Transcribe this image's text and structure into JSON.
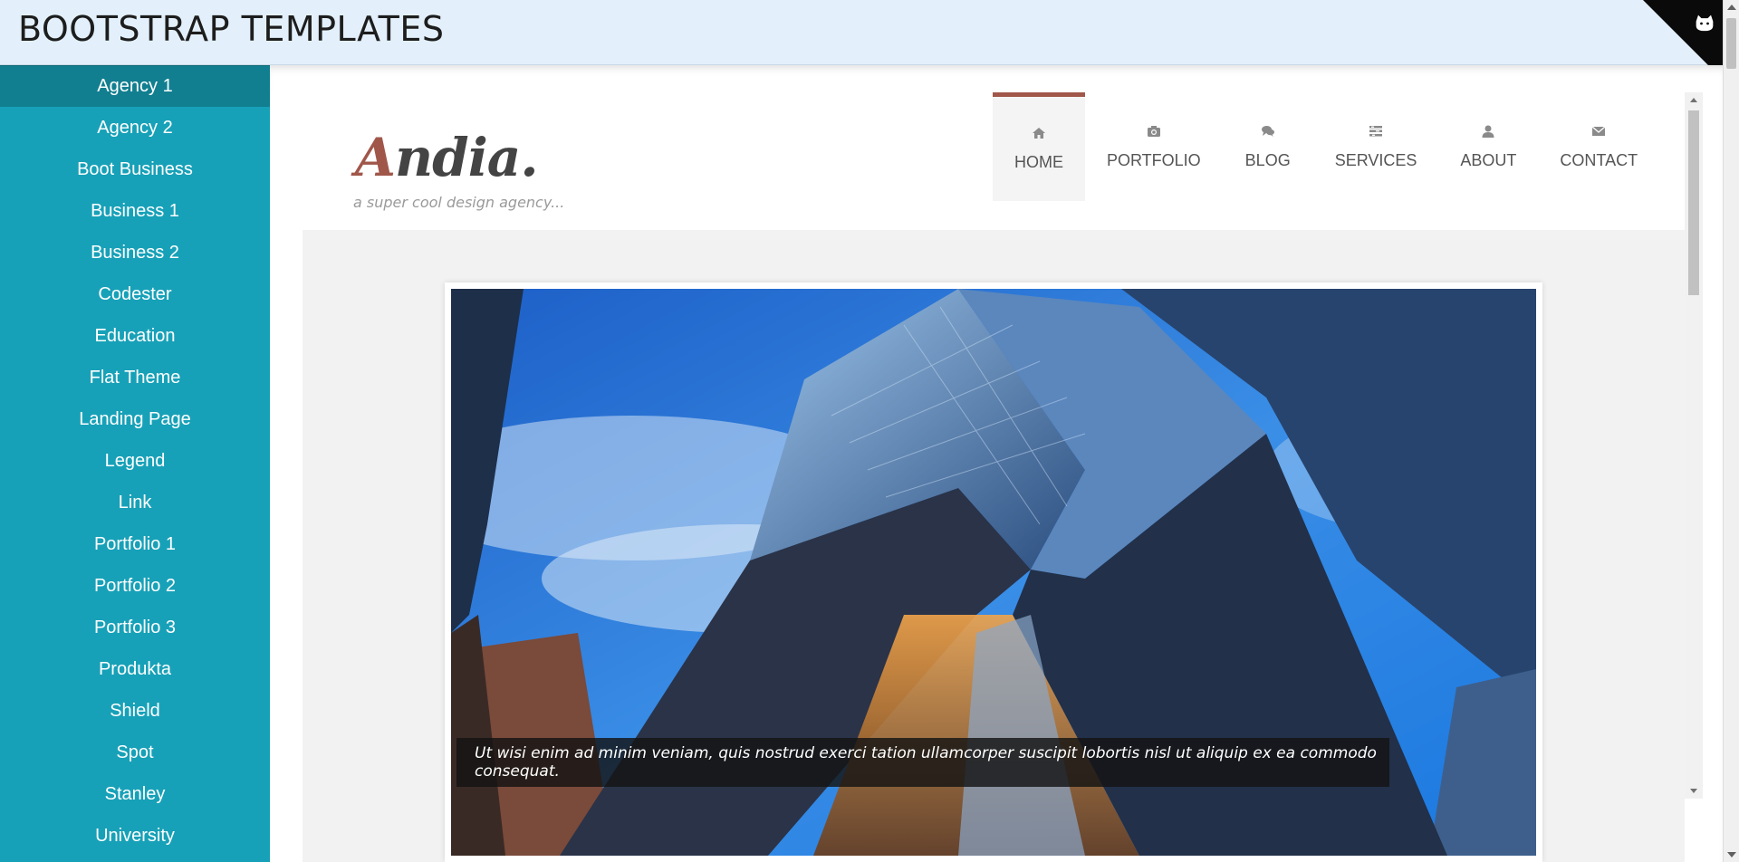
{
  "header": {
    "title": "BOOTSTRAP TEMPLATES",
    "corner_icon": "github-cat-icon"
  },
  "sidebar": {
    "active_index": 0,
    "items": [
      {
        "label": "Agency 1"
      },
      {
        "label": "Agency 2"
      },
      {
        "label": "Boot Business"
      },
      {
        "label": "Business 1"
      },
      {
        "label": "Business 2"
      },
      {
        "label": "Codester"
      },
      {
        "label": "Education"
      },
      {
        "label": "Flat Theme"
      },
      {
        "label": "Landing Page"
      },
      {
        "label": "Legend"
      },
      {
        "label": "Link"
      },
      {
        "label": "Portfolio 1"
      },
      {
        "label": "Portfolio 2"
      },
      {
        "label": "Portfolio 3"
      },
      {
        "label": "Produkta"
      },
      {
        "label": "Shield"
      },
      {
        "label": "Spot"
      },
      {
        "label": "Stanley"
      },
      {
        "label": "University"
      }
    ]
  },
  "site": {
    "logo_first": "A",
    "logo_rest": "ndia.",
    "tagline": "a super cool design agency...",
    "nav": [
      {
        "label": "HOME",
        "icon": "home-icon",
        "active": true
      },
      {
        "label": "PORTFOLIO",
        "icon": "camera-icon",
        "active": false
      },
      {
        "label": "BLOG",
        "icon": "comments-icon",
        "active": false
      },
      {
        "label": "SERVICES",
        "icon": "list-icon",
        "active": false
      },
      {
        "label": "ABOUT",
        "icon": "user-icon",
        "active": false
      },
      {
        "label": "CONTACT",
        "icon": "envelope-icon",
        "active": false
      }
    ],
    "slide_caption": "Ut wisi enim ad minim veniam, quis nostrud exerci tation ullamcorper suscipit lobortis nisl ut aliquip ex ea commodo consequat."
  },
  "colors": {
    "sidebar": "#17a1b8",
    "sidebar_active": "#117f90",
    "header_bg": "#e3f0fb",
    "accent": "#a0574a"
  }
}
